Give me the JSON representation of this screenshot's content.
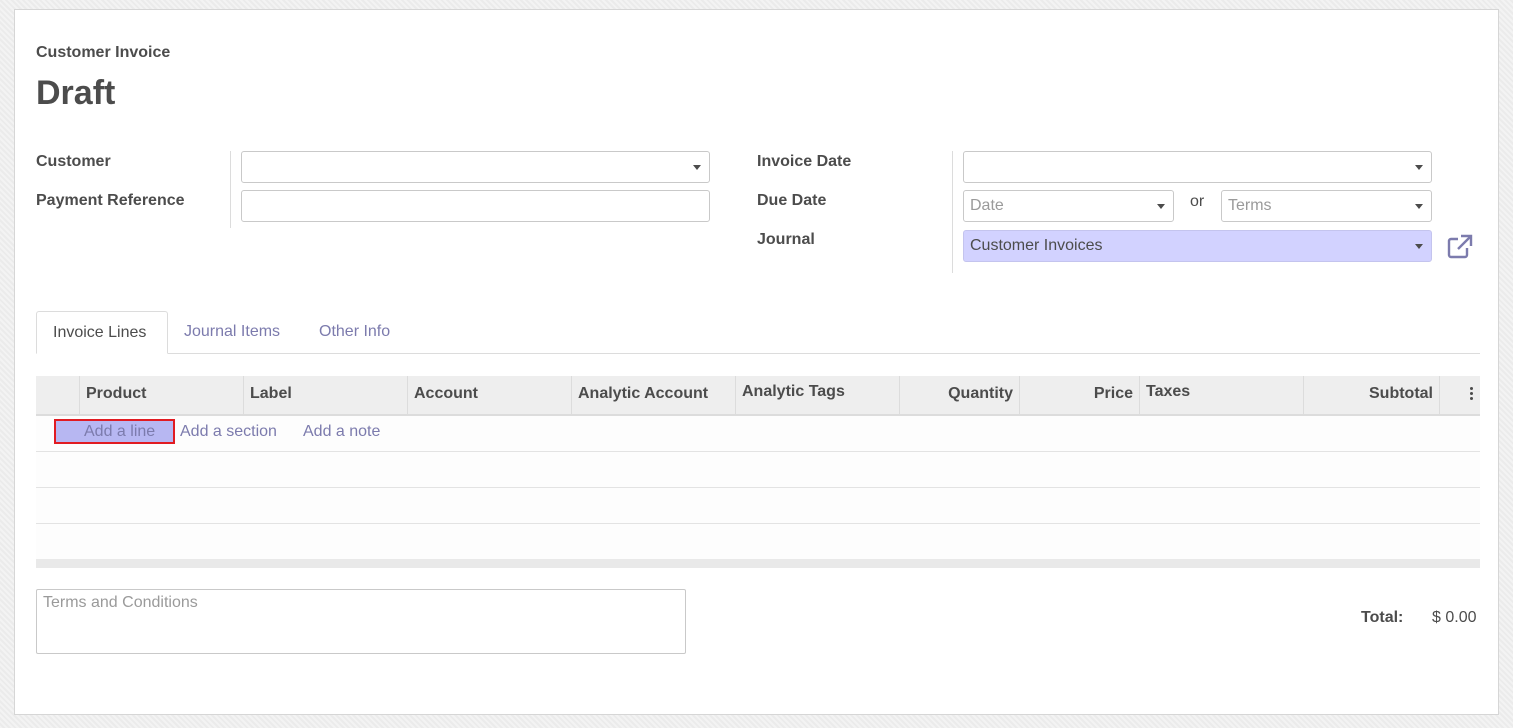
{
  "header": {
    "subtitle": "Customer Invoice",
    "title": "Draft"
  },
  "form": {
    "customer_label": "Customer",
    "customer_value": "",
    "payment_reference_label": "Payment Reference",
    "payment_reference_value": "",
    "invoice_date_label": "Invoice Date",
    "invoice_date_value": "",
    "due_date_label": "Due Date",
    "due_date_placeholder": "Date",
    "or_label": "or",
    "terms_placeholder": "Terms",
    "journal_label": "Journal",
    "journal_value": "Customer Invoices"
  },
  "tabs": [
    {
      "label": "Invoice Lines",
      "active": true
    },
    {
      "label": "Journal Items",
      "active": false
    },
    {
      "label": "Other Info",
      "active": false
    }
  ],
  "table": {
    "columns": [
      "Product",
      "Label",
      "Account",
      "Analytic Account",
      "Analytic Tags",
      "Quantity",
      "Price",
      "Taxes",
      "Subtotal"
    ],
    "add_line": "Add a line",
    "add_section": "Add a section",
    "add_note": "Add a note"
  },
  "footer": {
    "terms_placeholder": "Terms and Conditions",
    "total_label": "Total:",
    "total_value": "$ 0.00"
  },
  "colors": {
    "accent": "#7c7bad",
    "highlight": "#d2d2ff",
    "focus_outline": "#e11b22"
  },
  "icons": {
    "external_link": "external-link-icon",
    "dropdown": "caret-down-icon",
    "column_options": "kebab-icon"
  }
}
